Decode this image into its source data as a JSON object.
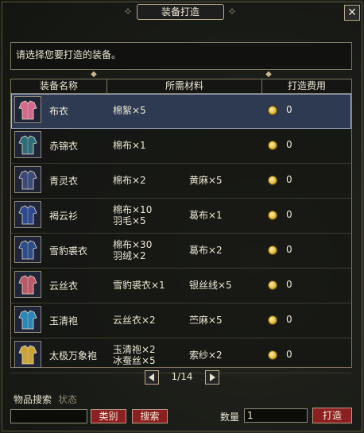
{
  "window": {
    "title": "装备打造",
    "close_icon": "close-icon"
  },
  "prompt": "请选择您要打造的装备。",
  "columns": {
    "name": "装备名称",
    "materials": "所需材料",
    "cost": "打造费用"
  },
  "items": [
    {
      "name": "布衣",
      "mat1": [
        "棉絮×5"
      ],
      "mat2": [],
      "cost": "0",
      "selected": true,
      "icon": "cloth-robe-icon",
      "color": "#d16a8c"
    },
    {
      "name": "赤锦衣",
      "mat1": [
        "棉布×1"
      ],
      "mat2": [],
      "cost": "0",
      "selected": false,
      "icon": "red-brocade-icon",
      "color": "#2f6e78"
    },
    {
      "name": "青灵衣",
      "mat1": [
        "棉布×2"
      ],
      "mat2": [
        "黄麻×5"
      ],
      "cost": "0",
      "selected": false,
      "icon": "green-spirit-robe-icon",
      "color": "#3b4a7a"
    },
    {
      "name": "褐云衫",
      "mat1": [
        "棉布×10",
        "羽毛×5"
      ],
      "mat2": [
        "葛布×1"
      ],
      "cost": "0",
      "selected": false,
      "icon": "brown-cloud-shirt-icon",
      "color": "#2e4a8e"
    },
    {
      "name": "雪豹裘衣",
      "mat1": [
        "棉布×30",
        "羽绒×2"
      ],
      "mat2": [
        "葛布×2"
      ],
      "cost": "0",
      "selected": false,
      "icon": "snow-leopard-fur-icon",
      "color": "#2c4d8a"
    },
    {
      "name": "云丝衣",
      "mat1": [
        "雪豹裘衣×1"
      ],
      "mat2": [
        "银丝线×5"
      ],
      "cost": "0",
      "selected": false,
      "icon": "cloud-silk-robe-icon",
      "color": "#b85a6a"
    },
    {
      "name": "玉清袍",
      "mat1": [
        "云丝衣×2"
      ],
      "mat2": [
        "苎麻×5"
      ],
      "cost": "0",
      "selected": false,
      "icon": "jade-clear-robe-icon",
      "color": "#2d86b8"
    },
    {
      "name": "太极万象袍",
      "mat1": [
        "玉清袍×2",
        "冰蚕丝×5"
      ],
      "mat2": [
        "索纱×2"
      ],
      "cost": "0",
      "selected": false,
      "icon": "taiji-robe-icon",
      "color": "#c9a23a"
    }
  ],
  "pager": {
    "text": "1/14"
  },
  "bottom": {
    "section_label": "物品搜索",
    "status_label": "状态",
    "search_value": "",
    "category_button": "类别",
    "search_button": "搜索",
    "quantity_label": "数量",
    "quantity_value": "1",
    "forge_button": "打造"
  }
}
